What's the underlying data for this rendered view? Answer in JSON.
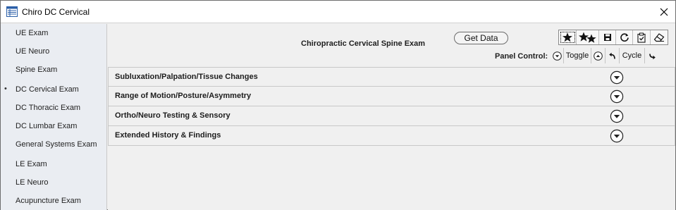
{
  "window": {
    "title": "Chiro DC Cervical",
    "close_icon": "close-icon"
  },
  "sidebar": {
    "items": [
      {
        "label": "UE Exam",
        "selected": false
      },
      {
        "label": "UE Neuro",
        "selected": false
      },
      {
        "label": "Spine Exam",
        "selected": false
      },
      {
        "label": "DC Cervical Exam",
        "selected": true,
        "bullet": "•"
      },
      {
        "label": "DC Thoracic Exam",
        "selected": false
      },
      {
        "label": "DC Lumbar Exam",
        "selected": false
      },
      {
        "label": "General Systems Exam",
        "selected": false
      },
      {
        "label": "LE Exam",
        "selected": false
      },
      {
        "label": "LE Neuro",
        "selected": false
      },
      {
        "label": "Acupuncture Exam",
        "selected": false
      }
    ]
  },
  "main": {
    "title": "Chiropractic Cervical Spine Exam",
    "get_data_label": "Get Data",
    "toolbar": {
      "icons": [
        "star-icon",
        "double-star-icon",
        "save-icon",
        "refresh-icon",
        "clipboard-check-icon",
        "eraser-icon"
      ]
    },
    "panel_control": {
      "label": "Panel Control:",
      "toggle_label": "Toggle",
      "cycle_label": "Cycle"
    },
    "sections": [
      {
        "title": "Subluxation/Palpation/Tissue Changes"
      },
      {
        "title": "Range of Motion/Posture/Asymmetry"
      },
      {
        "title": "Ortho/Neuro Testing & Sensory"
      },
      {
        "title": "Extended History & Findings"
      }
    ]
  }
}
